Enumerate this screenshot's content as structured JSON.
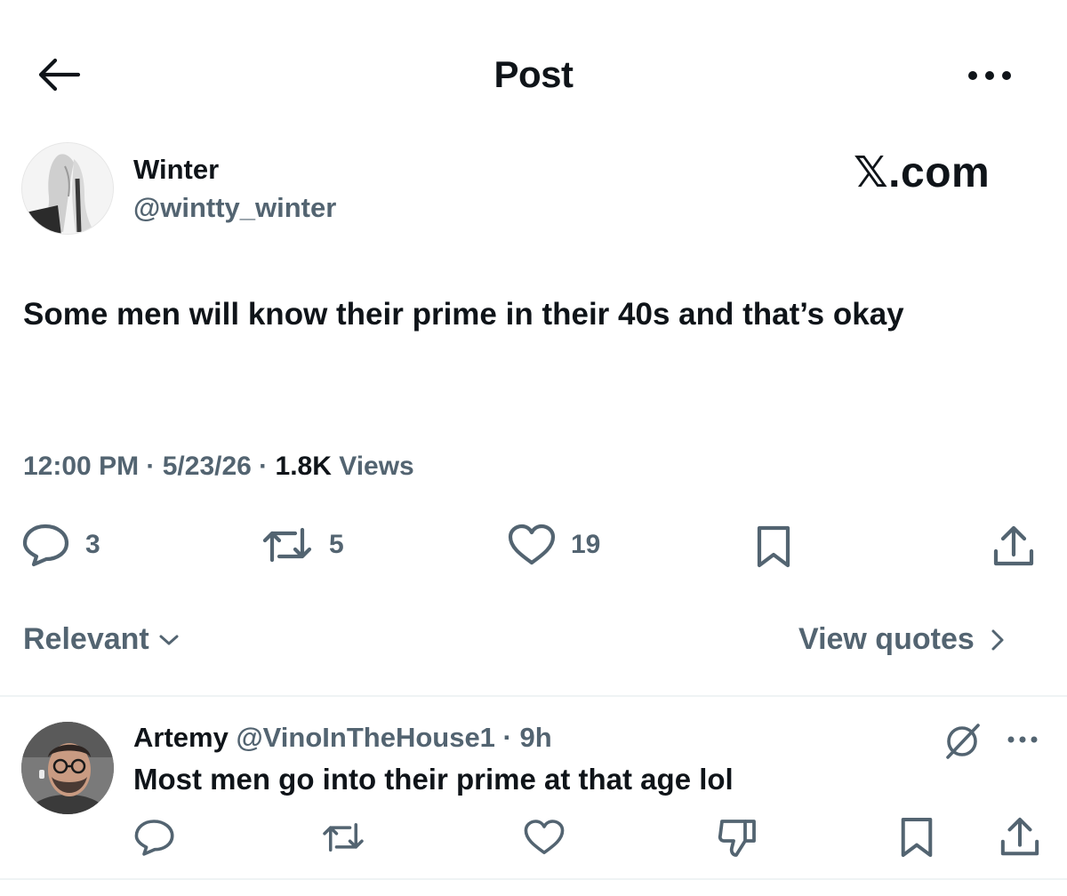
{
  "header": {
    "title": "Post",
    "back_icon": "arrow-left-icon",
    "more_icon": "more-horizontal-icon"
  },
  "author": {
    "name": "Winter",
    "handle": "@wintty_winter",
    "brand": "𝕏.com"
  },
  "post": {
    "text": "Some men will know their prime in their 40s and that’s okay",
    "time": "12:00 PM",
    "date": "5/23/26",
    "views_count": "1.8K",
    "views_label": "Views",
    "separator": " · "
  },
  "actions": {
    "replies": "3",
    "reposts": "5",
    "likes": "19"
  },
  "sort": {
    "label": "Relevant",
    "quotes_label": "View quotes"
  },
  "reply": {
    "name": "Artemy",
    "handle": "@VinoInTheHouse1",
    "separator": " · ",
    "time": "9h",
    "text": "Most men go into their prime at that age lol"
  },
  "colors": {
    "text_primary": "#0f1419",
    "text_secondary": "#536471",
    "divider": "#eff3f4",
    "background": "#ffffff"
  }
}
